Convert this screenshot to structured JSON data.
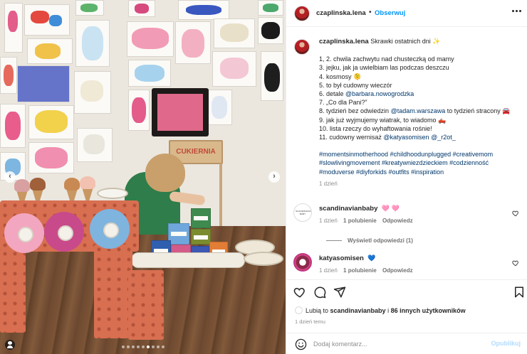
{
  "post": {
    "author": "czaplinska.lena",
    "follow_label": "Obserwuj",
    "more_icon": "more-horizontal-icon"
  },
  "media": {
    "sign_text": "CUKIERNIA",
    "prev_icon": "chevron-left-icon",
    "next_icon": "chevron-right-icon",
    "slide_count": 9,
    "active_slide": 6
  },
  "caption": {
    "author": "czaplinska.lena",
    "title": "Skrawki ostatnich dni ✨",
    "lines": {
      "l1": "1, 2. chwila zachwytu nad chusteczką od mamy",
      "l2": "3. jejku, jak ja uwielbiam las podczas deszczu",
      "l3": "4. kosmosy 🫠",
      "l4": "5. to był cudowny wieczór",
      "l5_pre": "6. detale ",
      "l5_link": "@barbara.nowogrodzka",
      "l6": "7. „Co dla Pani?”",
      "l7_pre": "8. tydzień bez odwiedzin ",
      "l7_link": "@tadam.warszawa",
      "l7_post": " to tydzień stracony 🚘",
      "l8": "9. jak już wyjmujemy wiatrak, to wiadomo 🛻",
      "l9": "10. lista rzeczy do wyhaftowania rośnie!",
      "l10_pre": "11. cudowny wernisaż ",
      "l10_link1": "@katyasomisen",
      "l10_link2": "@_r2ot_"
    },
    "hashtags": {
      "h1": "#momentsinmotherhood #childhoodunplugged #creativemom",
      "h2": "#slowlivingmovement #kreatywniezdzieckiem #codzienność",
      "h3": "#moduverse #diyforkids #outfits #inspiration"
    },
    "time": "1 dzień"
  },
  "comments": [
    {
      "user": "scandinavianbaby",
      "text": "🩷 🩷",
      "time": "1 dzień",
      "likes": "1 polubienie",
      "reply": "Odpowiedz",
      "view_replies": "Wyświetl odpowiedzi (1)",
      "avatar_text": "SCANDINAVIAN BABY"
    },
    {
      "user": "katyasomisen",
      "text": "💙",
      "time": "1 dzień",
      "likes": "1 polubienie",
      "reply": "Odpowiedz"
    }
  ],
  "actions": {
    "like_icon": "heart-icon",
    "comment_icon": "comment-icon",
    "share_icon": "send-icon",
    "save_icon": "bookmark-icon"
  },
  "likes": {
    "prefix": "Lubią to ",
    "user": "scandinavianbaby",
    "middle": " i ",
    "others": "86 innych użytkowników"
  },
  "date": "1 dzień temu",
  "comment_input": {
    "placeholder": "Dodaj komentarz...",
    "publish": "Opublikuj",
    "emoji_icon": "smiley-icon"
  },
  "colors": {
    "accent": "#0095f6",
    "link": "#00376b",
    "muted": "#8e8e8e",
    "publish_disabled": "#b3dbff"
  }
}
